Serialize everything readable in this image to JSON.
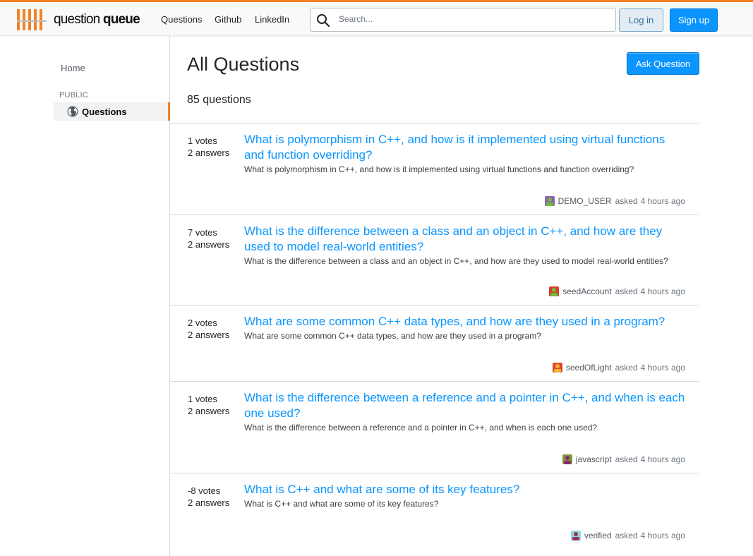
{
  "header": {
    "logo_text_light": "question ",
    "logo_text_bold": "queue",
    "nav": [
      "Questions",
      "Github",
      "LinkedIn"
    ],
    "search_placeholder": "Search...",
    "login_label": "Log in",
    "signup_label": "Sign up"
  },
  "sidebar": {
    "home": "Home",
    "section": "PUBLIC",
    "questions": "Questions"
  },
  "main": {
    "title": "All Questions",
    "ask_label": "Ask Question",
    "count": "85 questions"
  },
  "colors": {
    "accent": "#f48225",
    "primary": "#0a95ff",
    "link": "#0a95ff"
  },
  "questions": [
    {
      "votes": "1 votes",
      "answers": "2 answers",
      "title": "What is polymorphism in C++, and how is it implemented using virtual functions and function overriding?",
      "excerpt": "What is polymorphism in C++, and how is it implemented using virtual functions and function overriding?",
      "user": "DEMO_USER",
      "asked": "asked",
      "time": "4 hours ago",
      "avatar_bg": "#8d5fb5",
      "avatar_fg": "#6cbf3a"
    },
    {
      "votes": "7 votes",
      "answers": "2 answers",
      "title": "What is the difference between a class and an object in C++, and how are they used to model real-world entities?",
      "excerpt": "What is the difference between a class and an object in C++, and how are they used to model real-world entities?",
      "user": "seedAccount",
      "asked": "asked",
      "time": "4 hours ago",
      "avatar_bg": "#d93a2b",
      "avatar_fg": "#6cbf3a"
    },
    {
      "votes": "2 votes",
      "answers": "2 answers",
      "title": "What are some common C++ data types, and how are they used in a program?",
      "excerpt": "What are some common C++ data types, and how are they used in a program?",
      "user": "seedOfLight",
      "asked": "asked",
      "time": "4 hours ago",
      "avatar_bg": "#e0462a",
      "avatar_fg": "#f2b33d"
    },
    {
      "votes": "1 votes",
      "answers": "2 answers",
      "title": "What is the difference between a reference and a pointer in C++, and when is each one used?",
      "excerpt": "What is the difference between a reference and a pointer in C++, and when is each one used?",
      "user": "javascript",
      "asked": "asked",
      "time": "4 hours ago",
      "avatar_bg": "#7f9a3c",
      "avatar_fg": "#8b2a6b"
    },
    {
      "votes": "-8 votes",
      "answers": "2 answers",
      "title": "What is C++ and what are some of its key features?",
      "excerpt": "What is C++ and what are some of its key features?",
      "user": "verified",
      "asked": "asked",
      "time": "4 hours ago",
      "avatar_bg": "#8fd9cf",
      "avatar_fg": "#9b2f6a"
    }
  ]
}
